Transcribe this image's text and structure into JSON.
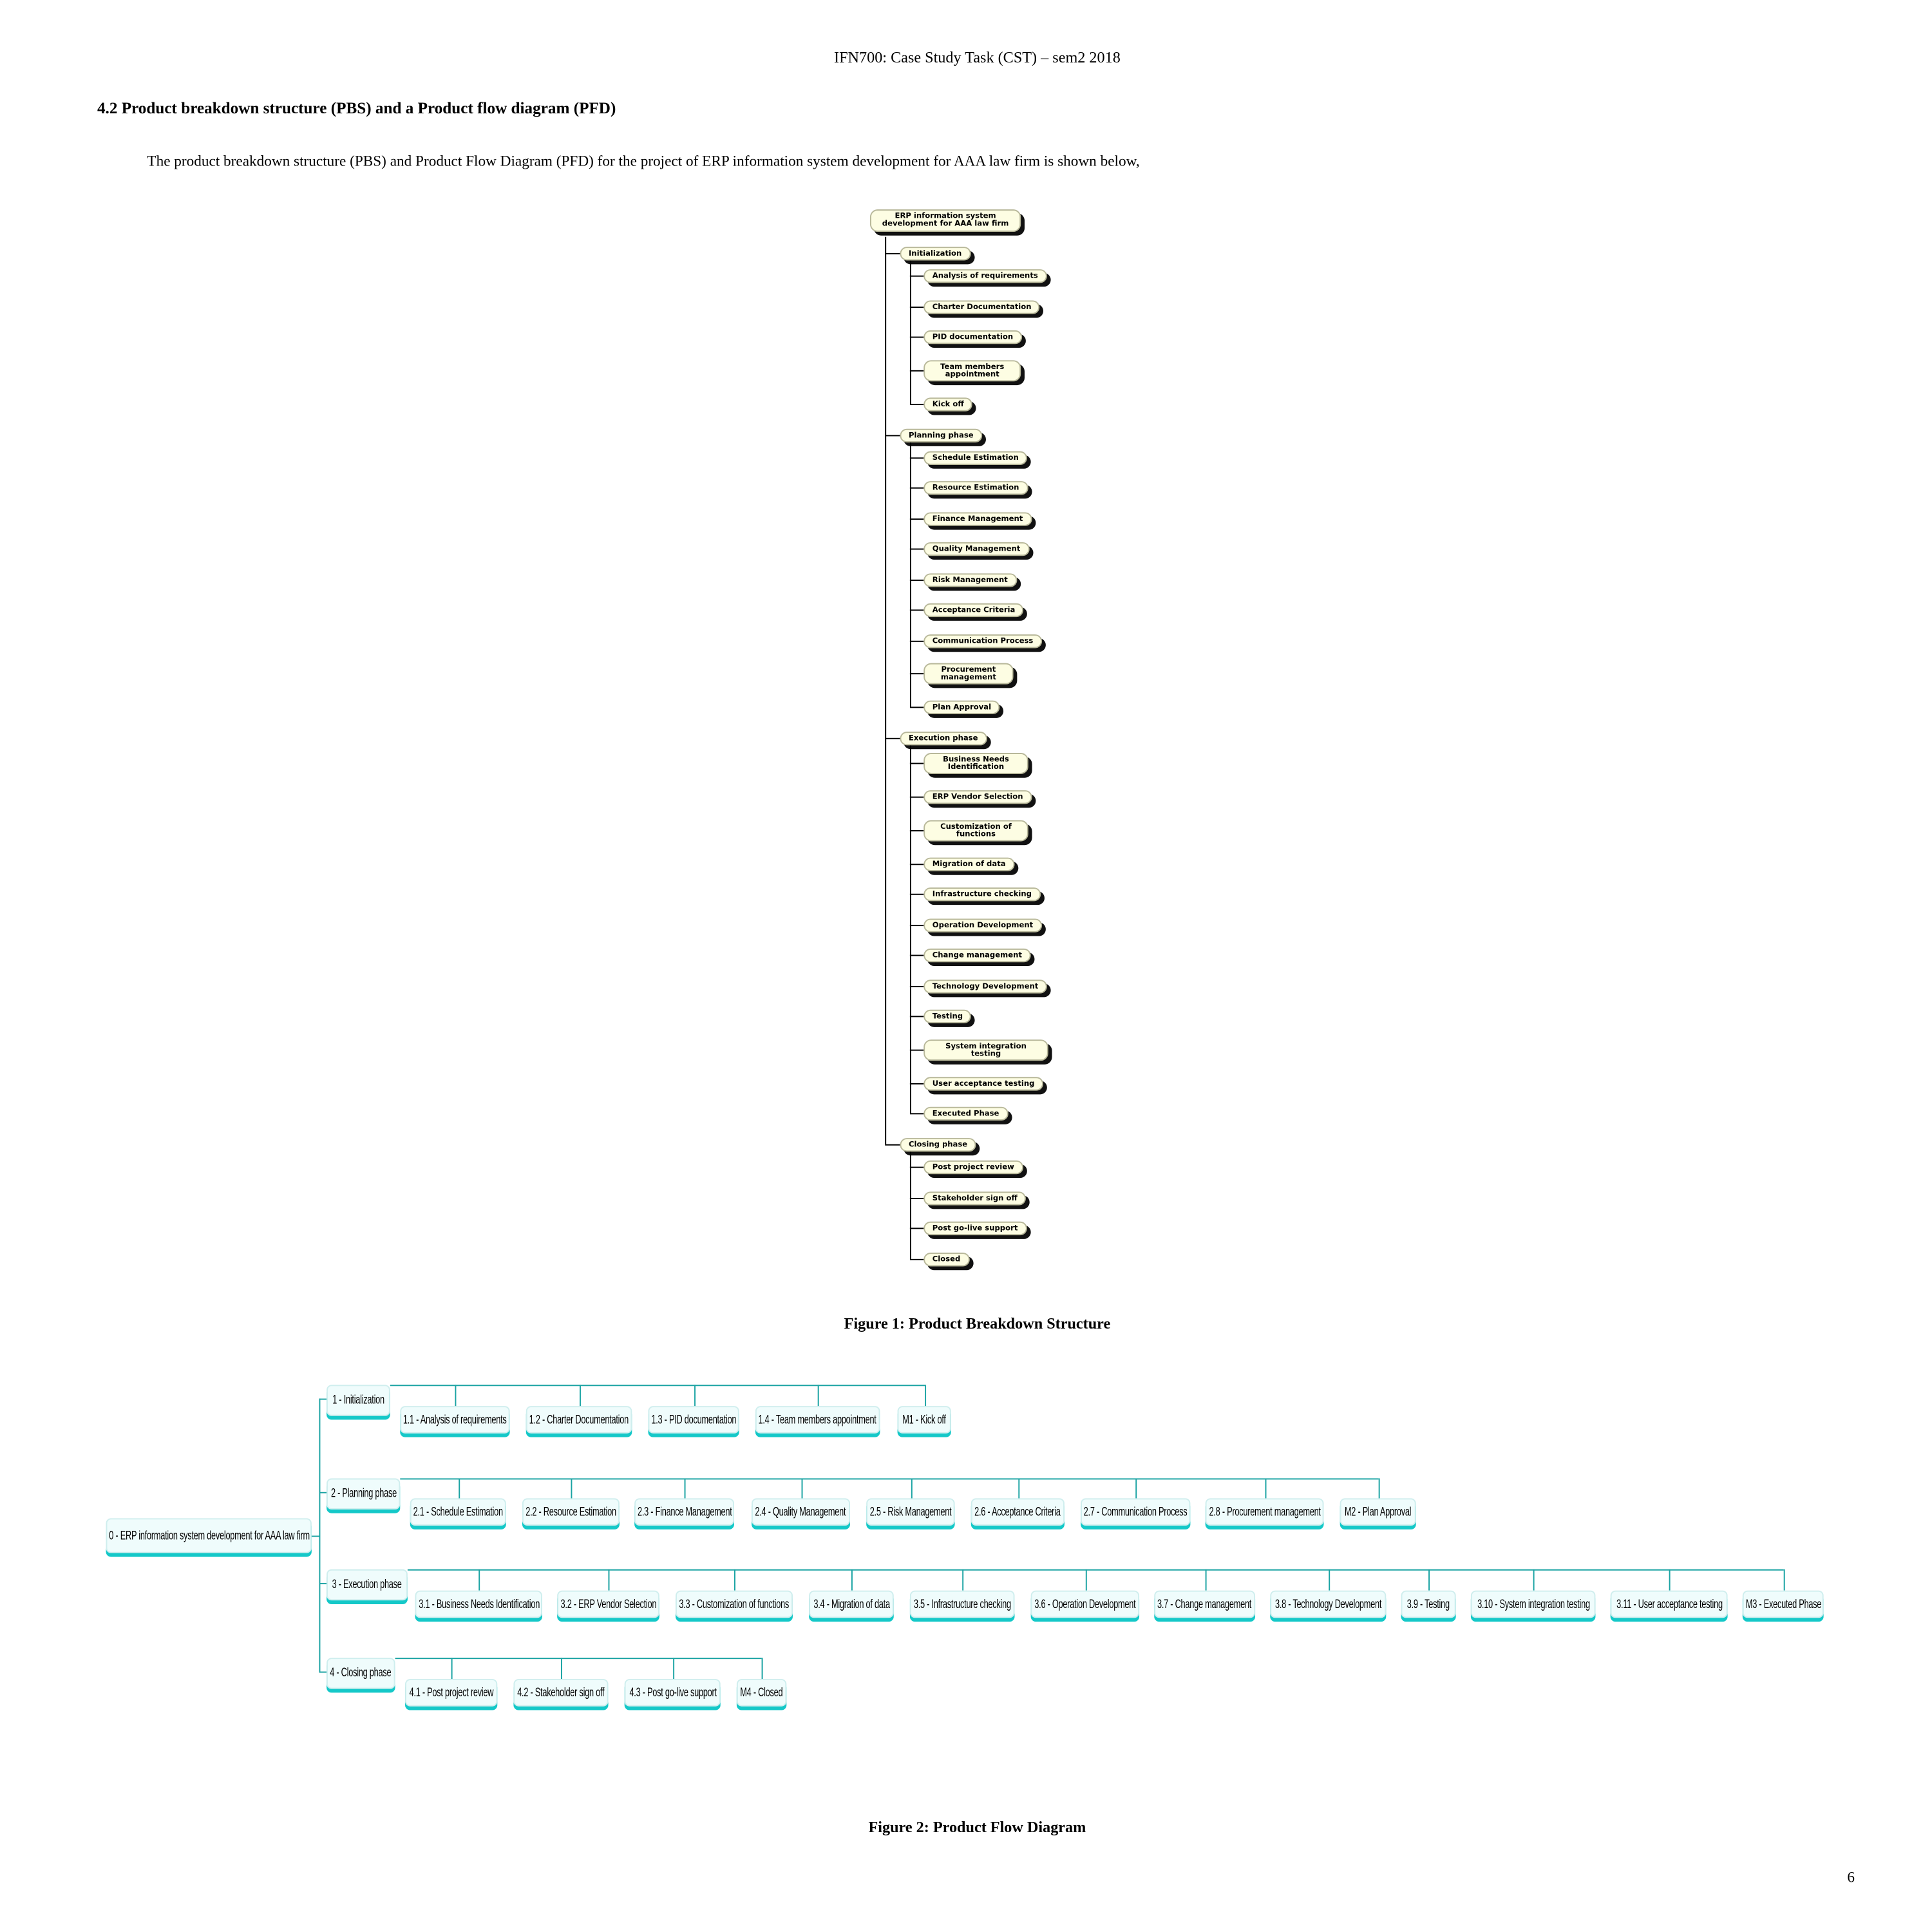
{
  "header": "IFN700: Case Study Task (CST) – sem2 2018",
  "section_heading": "4.2 Product breakdown structure (PBS) and a Product flow diagram (PFD)",
  "intro": "The product breakdown structure (PBS) and Product Flow Diagram (PFD) for the project of ERP information system development for AAA law firm is shown below,",
  "pbs": {
    "root": "ERP information system development for AAA law firm",
    "phases": [
      {
        "label": "Initialization",
        "items": [
          "Analysis of requirements",
          "Charter Documentation",
          "PID documentation",
          "Team members appointment",
          "Kick off"
        ]
      },
      {
        "label": "Planning phase",
        "items": [
          "Schedule Estimation",
          "Resource Estimation",
          "Finance Management",
          "Quality Management",
          "Risk Management",
          "Acceptance Criteria",
          "Communication Process",
          "Procurement management",
          "Plan Approval"
        ]
      },
      {
        "label": "Execution phase",
        "items": [
          "Business Needs Identification",
          "ERP Vendor Selection",
          "Customization of functions",
          "Migration of data",
          "Infrastructure checking",
          "Operation Development",
          "Change management",
          "Technology Development",
          "Testing",
          "System integration testing",
          "User acceptance testing",
          "Executed Phase"
        ]
      },
      {
        "label": "Closing phase",
        "items": [
          "Post project review",
          "Stakeholder sign off",
          "Post go-live support",
          "Closed"
        ]
      }
    ],
    "colors": {
      "box": "#fdfde3",
      "shadow": "#111111",
      "line": "#000000"
    }
  },
  "figure1_caption": "Figure 1: Product Breakdown Structure",
  "pfd": {
    "root": "0 -  ERP information system development for AAA law firm",
    "phases": [
      {
        "label": "1 -  Initialization",
        "items": [
          "1.1 - Analysis of requirements",
          "1.2 - Charter Documentation",
          "1.3 - PID documentation",
          "1.4 -  Team members appointment",
          "M1 - Kick off"
        ]
      },
      {
        "label": "2 -  Planning phase",
        "items": [
          "2.1 - Schedule Estimation",
          "2.2 - Resource Estimation",
          "2.3 -  Finance Management",
          "2.4 -  Quality Management",
          "2.5 - Risk Management",
          "2.6 -  Acceptance Criteria",
          "2.7 - Communication Process",
          "2.8 -  Procurement management",
          "M2 - Plan Approval"
        ]
      },
      {
        "label": "3 -  Execution phase",
        "items": [
          "3.1 - Business Needs Identification",
          "3.2 -  ERP Vendor Selection",
          "3.3 - Customization of functions",
          "3.4 - Migration of data",
          "3.5 - Infrastructure checking",
          "3.6 -  Operation Development",
          "3.7 -  Change management",
          "3.8 - Technology Development",
          "3.9 - Testing",
          "3.10 - System integration testing",
          "3.11 -  User acceptance testing",
          "M3 - Executed Phase"
        ]
      },
      {
        "label": "4 -  Closing phase",
        "items": [
          "4.1 - Post project review",
          "4.2 - Stakeholder sign off",
          "4.3 - Post go-live support",
          "M4 - Closed"
        ]
      }
    ],
    "colors": {
      "box": "#effcfc",
      "shadow": "#14c8c8",
      "line": "#1aa3a3"
    }
  },
  "figure2_caption": "Figure 2: Product Flow Diagram",
  "page_number": "6"
}
